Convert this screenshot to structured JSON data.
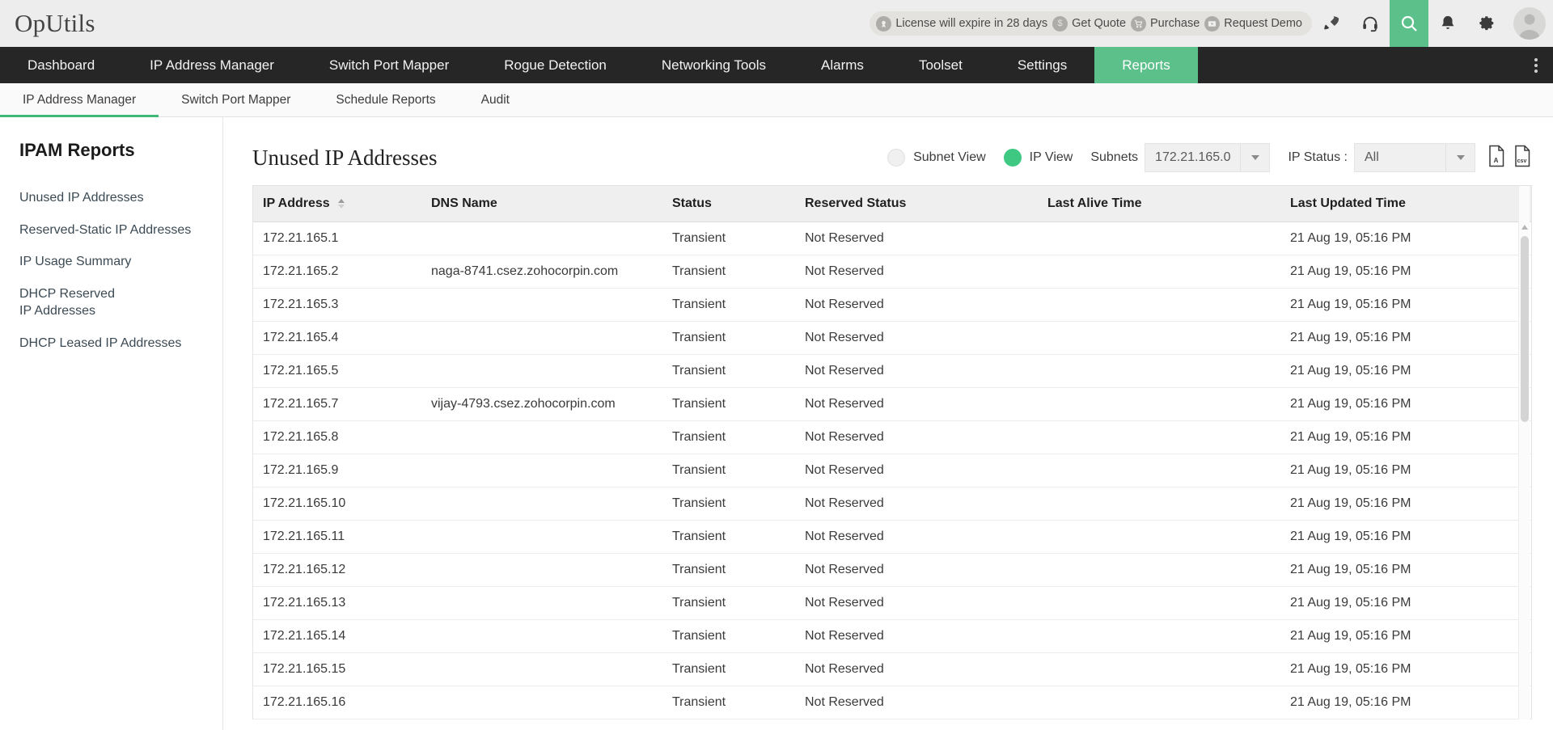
{
  "topbar": {
    "brand": "OpUtils",
    "license": {
      "icon": "license-badge-icon",
      "text": "License will expire in 28 days"
    },
    "links": [
      {
        "icon": "dollar-icon",
        "label": "Get Quote"
      },
      {
        "icon": "cart-icon",
        "label": "Purchase"
      },
      {
        "icon": "video-icon",
        "label": "Request Demo"
      }
    ],
    "icons": [
      {
        "name": "rocket-icon",
        "active": false
      },
      {
        "name": "headset-icon",
        "active": false
      },
      {
        "name": "search-icon",
        "active": true
      },
      {
        "name": "bell-icon",
        "active": false
      },
      {
        "name": "gear-icon",
        "active": false
      }
    ],
    "avatar": "user-avatar"
  },
  "mainnav": {
    "items": [
      {
        "label": "Dashboard",
        "active": false
      },
      {
        "label": "IP Address Manager",
        "active": false
      },
      {
        "label": "Switch Port Mapper",
        "active": false
      },
      {
        "label": "Rogue Detection",
        "active": false
      },
      {
        "label": "Networking Tools",
        "active": false
      },
      {
        "label": "Alarms",
        "active": false
      },
      {
        "label": "Toolset",
        "active": false
      },
      {
        "label": "Settings",
        "active": false
      },
      {
        "label": "Reports",
        "active": true
      }
    ],
    "accent": "#5cc08b"
  },
  "subnav": {
    "items": [
      {
        "label": "IP Address Manager",
        "active": true
      },
      {
        "label": "Switch Port Mapper",
        "active": false
      },
      {
        "label": "Schedule Reports",
        "active": false
      },
      {
        "label": "Audit",
        "active": false
      }
    ],
    "accent": "#3fb878"
  },
  "sidebar": {
    "title": "IPAM Reports",
    "items": [
      {
        "label": "Unused IP Addresses"
      },
      {
        "label": "Reserved-Static IP Addresses"
      },
      {
        "label": "IP Usage Summary"
      },
      {
        "label": "DHCP Reserved IP Addresses"
      },
      {
        "label": "DHCP Leased IP Addresses"
      }
    ]
  },
  "main": {
    "title": "Unused IP Addresses",
    "view_toggle": {
      "subnet_label": "Subnet View",
      "ip_label": "IP View",
      "selected": "IP View"
    },
    "subnets": {
      "label": "Subnets",
      "value": "172.21.165.0"
    },
    "ip_status": {
      "label": "IP Status :",
      "value": "All"
    },
    "exports": [
      {
        "name": "export-pdf-icon",
        "label": "PDF"
      },
      {
        "name": "export-csv-icon",
        "label": "CSV"
      }
    ]
  },
  "table": {
    "columns": [
      {
        "key": "ip",
        "label": "IP Address",
        "sorted": "asc"
      },
      {
        "key": "dns",
        "label": "DNS Name",
        "sorted": ""
      },
      {
        "key": "status",
        "label": "Status",
        "sorted": ""
      },
      {
        "key": "reserved",
        "label": "Reserved Status",
        "sorted": ""
      },
      {
        "key": "alive",
        "label": "Last Alive Time",
        "sorted": ""
      },
      {
        "key": "updated",
        "label": "Last Updated Time",
        "sorted": ""
      }
    ],
    "rows": [
      {
        "ip": "172.21.165.1",
        "dns": "",
        "status": "Transient",
        "reserved": "Not Reserved",
        "alive": "",
        "updated": "21 Aug 19, 05:16 PM"
      },
      {
        "ip": "172.21.165.2",
        "dns": "naga-8741.csez.zohocorpin.com",
        "status": "Transient",
        "reserved": "Not Reserved",
        "alive": "",
        "updated": "21 Aug 19, 05:16 PM"
      },
      {
        "ip": "172.21.165.3",
        "dns": "",
        "status": "Transient",
        "reserved": "Not Reserved",
        "alive": "",
        "updated": "21 Aug 19, 05:16 PM"
      },
      {
        "ip": "172.21.165.4",
        "dns": "",
        "status": "Transient",
        "reserved": "Not Reserved",
        "alive": "",
        "updated": "21 Aug 19, 05:16 PM"
      },
      {
        "ip": "172.21.165.5",
        "dns": "",
        "status": "Transient",
        "reserved": "Not Reserved",
        "alive": "",
        "updated": "21 Aug 19, 05:16 PM"
      },
      {
        "ip": "172.21.165.7",
        "dns": "vijay-4793.csez.zohocorpin.com",
        "status": "Transient",
        "reserved": "Not Reserved",
        "alive": "",
        "updated": "21 Aug 19, 05:16 PM"
      },
      {
        "ip": "172.21.165.8",
        "dns": "",
        "status": "Transient",
        "reserved": "Not Reserved",
        "alive": "",
        "updated": "21 Aug 19, 05:16 PM"
      },
      {
        "ip": "172.21.165.9",
        "dns": "",
        "status": "Transient",
        "reserved": "Not Reserved",
        "alive": "",
        "updated": "21 Aug 19, 05:16 PM"
      },
      {
        "ip": "172.21.165.10",
        "dns": "",
        "status": "Transient",
        "reserved": "Not Reserved",
        "alive": "",
        "updated": "21 Aug 19, 05:16 PM"
      },
      {
        "ip": "172.21.165.11",
        "dns": "",
        "status": "Transient",
        "reserved": "Not Reserved",
        "alive": "",
        "updated": "21 Aug 19, 05:16 PM"
      },
      {
        "ip": "172.21.165.12",
        "dns": "",
        "status": "Transient",
        "reserved": "Not Reserved",
        "alive": "",
        "updated": "21 Aug 19, 05:16 PM"
      },
      {
        "ip": "172.21.165.13",
        "dns": "",
        "status": "Transient",
        "reserved": "Not Reserved",
        "alive": "",
        "updated": "21 Aug 19, 05:16 PM"
      },
      {
        "ip": "172.21.165.14",
        "dns": "",
        "status": "Transient",
        "reserved": "Not Reserved",
        "alive": "",
        "updated": "21 Aug 19, 05:16 PM"
      },
      {
        "ip": "172.21.165.15",
        "dns": "",
        "status": "Transient",
        "reserved": "Not Reserved",
        "alive": "",
        "updated": "21 Aug 19, 05:16 PM"
      },
      {
        "ip": "172.21.165.16",
        "dns": "",
        "status": "Transient",
        "reserved": "Not Reserved",
        "alive": "",
        "updated": "21 Aug 19, 05:16 PM"
      }
    ]
  }
}
